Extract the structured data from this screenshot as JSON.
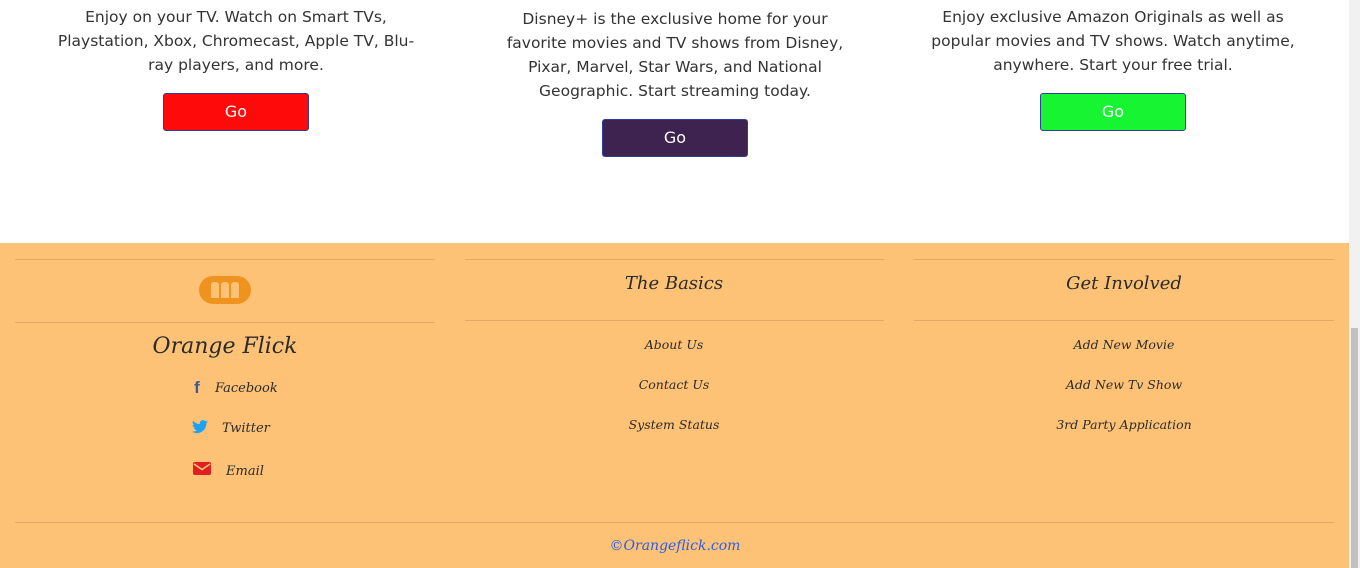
{
  "services": [
    {
      "description": "Enjoy on your TV. Watch on Smart TVs, Playstation, Xbox, Chromecast, Apple TV, Blu-ray players, and more.",
      "button_label": "Go",
      "button_color": "#ff0a0a"
    },
    {
      "description": "Disney+ is the exclusive home for your favorite movies and TV shows from Disney, Pixar, Marvel, Star Wars, and National Geographic. Start streaming today.",
      "button_label": "Go",
      "button_color": "#3e2351"
    },
    {
      "description": "Enjoy exclusive Amazon Originals as well as popular movies and TV shows. Watch anytime, anywhere. Start your free trial.",
      "button_label": "Go",
      "button_color": "#17f532"
    }
  ],
  "footer": {
    "brand_name": "Orange Flick",
    "social": [
      {
        "icon": "facebook-icon",
        "glyph": "f",
        "label": "Facebook",
        "color": "#3b5998"
      },
      {
        "icon": "twitter-icon",
        "glyph": "🐦",
        "label": "Twitter",
        "color": "#1da1f2"
      },
      {
        "icon": "email-icon",
        "glyph": "✉",
        "label": "Email",
        "color": "#e02020"
      }
    ],
    "basics": {
      "title": "The Basics",
      "links": [
        "About Us",
        "Contact Us",
        "System Status"
      ]
    },
    "involved": {
      "title": "Get Involved",
      "links": [
        "Add New Movie",
        "Add New Tv Show",
        "3rd Party Application"
      ]
    },
    "copyright": "©Orangeflick.com",
    "copyright_color": "#2c5ce8",
    "background": "#fdc276"
  }
}
